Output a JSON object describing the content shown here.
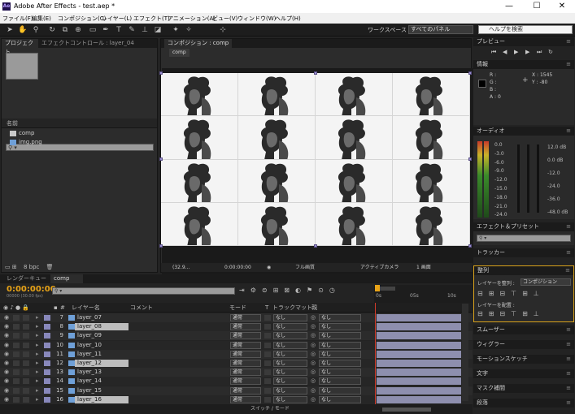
{
  "window": {
    "title": "Adobe After Effects - test.aep *",
    "app_badge": "Ae",
    "minimize": "—",
    "maximize": "☐",
    "close": "✕"
  },
  "menu": [
    "ファイル(F)",
    "編集(E)",
    "コンポジション(C)",
    "レイヤー(L)",
    "エフェクト(T)",
    "アニメーション(A)",
    "ビュー(V)",
    "ウィンドウ(W)",
    "ヘルプ(H)"
  ],
  "toolbar": {
    "workspace_label": "ワークスペース :",
    "workspace_value": "すべてのパネル",
    "help_search": "ヘルプを検索"
  },
  "project": {
    "tab": "プロジェクト",
    "effects_tab": "エフェクトコントロール : layer_04",
    "column_name": "名前",
    "items": [
      {
        "name": "comp",
        "type": "composition"
      },
      {
        "name": "img.png",
        "type": "image"
      }
    ],
    "bpc": "8 bpc"
  },
  "composition": {
    "tab": "コンポジション : comp",
    "breadcrumb": "comp",
    "zoom": "(32.9...",
    "timecode": "0:00:00:00",
    "resolution": "フル画質",
    "camera": "アクティブカメラ",
    "views": "1 画面"
  },
  "preview": {
    "title": "プレビュー"
  },
  "info": {
    "title": "情報",
    "r": "R :",
    "g": "G :",
    "b": "B :",
    "a": "A : 0",
    "x": "X : 1545",
    "y": "Y : -80"
  },
  "audio": {
    "title": "オーディオ",
    "left_scale": [
      "0.0",
      "-3.0",
      "-6.0",
      "-9.0",
      "-12.0",
      "-15.0",
      "-18.0",
      "-21.0",
      "-24.0"
    ],
    "right_scale": [
      "12.0 dB",
      "0.0 dB",
      "-12.0",
      "-24.0",
      "-36.0",
      "-48.0 dB"
    ]
  },
  "effects_presets": {
    "title": "エフェクト＆プリセット"
  },
  "tracker": {
    "title": "トラッカー"
  },
  "align": {
    "title": "整列",
    "align_to_label": "レイヤーを整列 :",
    "align_to_value": "コンポジション",
    "distribute_label": "レイヤーを配置 :"
  },
  "collapsed_panels": [
    "スムーザー",
    "ウィグラー",
    "モーションスケッチ",
    "文字",
    "マスク補間",
    "段落"
  ],
  "timeline": {
    "tabs": [
      "レンダーキュー",
      "comp"
    ],
    "timecode": "0:00:00:00",
    "frame_info": "00000 (30.00 fps)",
    "col_layer_name": "レイヤー名",
    "col_comment": "コメント",
    "col_mode": "モード",
    "col_t": "T",
    "col_trkmat": "トラックマット",
    "col_parent": "親",
    "ruler": [
      "0s",
      "05s",
      "10s"
    ],
    "footer": "スイッチ / モード",
    "layers": [
      {
        "num": "7",
        "name": "layer_07",
        "mode": "通常",
        "trkmat": "なし",
        "parent": "なし",
        "color": "#8888bb"
      },
      {
        "num": "8",
        "name": "layer_08",
        "mode": "通常",
        "trkmat": "なし",
        "parent": "なし",
        "color": "#8888bb"
      },
      {
        "num": "9",
        "name": "layer_09",
        "mode": "通常",
        "trkmat": "なし",
        "parent": "なし",
        "color": "#8888bb"
      },
      {
        "num": "10",
        "name": "layer_10",
        "mode": "通常",
        "trkmat": "なし",
        "parent": "なし",
        "color": "#8888bb"
      },
      {
        "num": "11",
        "name": "layer_11",
        "mode": "通常",
        "trkmat": "なし",
        "parent": "なし",
        "color": "#8888bb"
      },
      {
        "num": "12",
        "name": "layer_12",
        "mode": "通常",
        "trkmat": "なし",
        "parent": "なし",
        "color": "#8888bb"
      },
      {
        "num": "13",
        "name": "layer_13",
        "mode": "通常",
        "trkmat": "なし",
        "parent": "なし",
        "color": "#8888bb"
      },
      {
        "num": "14",
        "name": "layer_14",
        "mode": "通常",
        "trkmat": "なし",
        "parent": "なし",
        "color": "#8888bb"
      },
      {
        "num": "15",
        "name": "layer_15",
        "mode": "通常",
        "trkmat": "なし",
        "parent": "なし",
        "color": "#8888bb"
      },
      {
        "num": "16",
        "name": "layer_16",
        "mode": "通常",
        "trkmat": "なし",
        "parent": "なし",
        "color": "#8888bb"
      }
    ]
  }
}
